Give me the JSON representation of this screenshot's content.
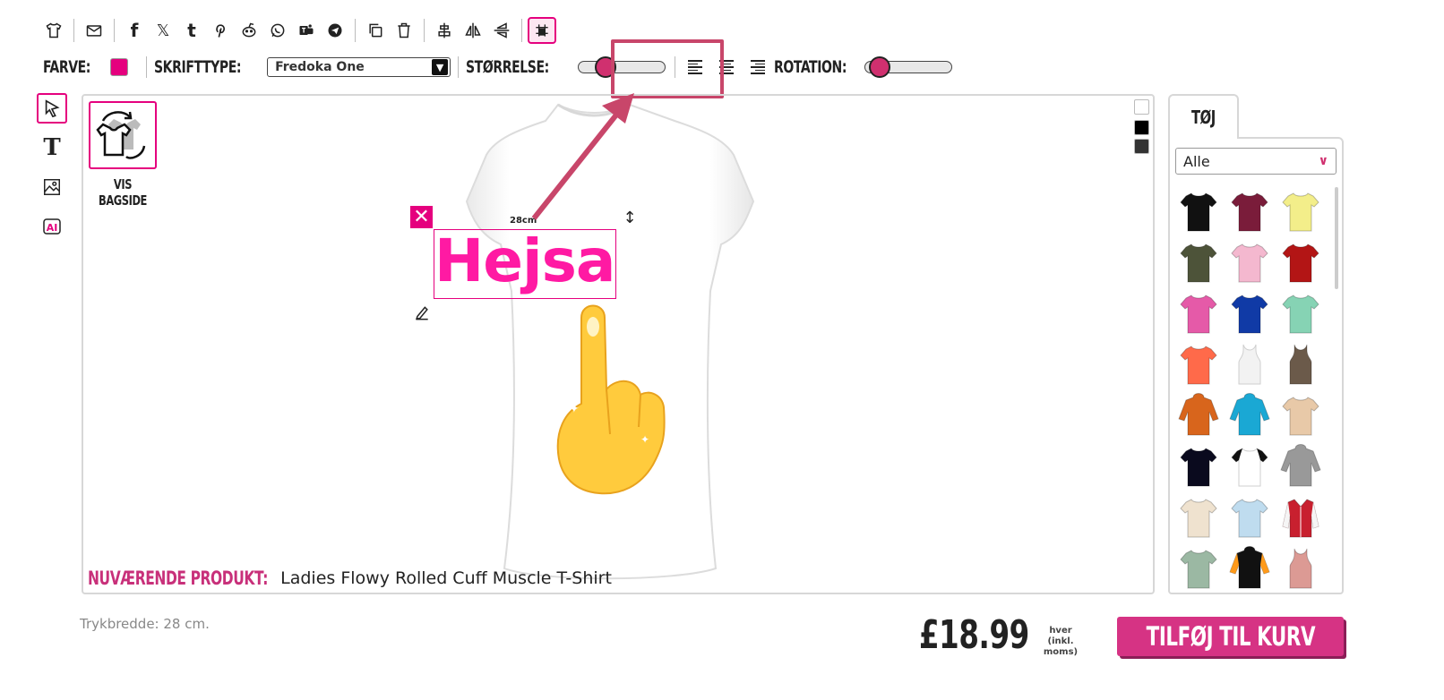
{
  "toolbar": {
    "icons": [
      "tshirt-icon",
      "mail-icon",
      "facebook-icon",
      "x-icon",
      "tumblr-icon",
      "pinterest-icon",
      "reddit-icon",
      "whatsapp-icon",
      "teams-icon",
      "telegram-icon",
      "duplicate-icon",
      "trash-icon",
      "align-center-vertical-icon",
      "flip-horizontal-icon",
      "flip-vertical-icon",
      "print-area-icon"
    ],
    "glyphs": {
      "facebook": "f",
      "x": "𝕏",
      "tumblr": "t"
    }
  },
  "options": {
    "color_label": "FARVE:",
    "color_value": "#e5007e",
    "font_label": "SKRIFTTYPE:",
    "font_value": "Fredoka One",
    "size_label": "STØRRELSE:",
    "size_level": 0.25,
    "rotation_label": "ROTATION:",
    "rotation_level": 0.05
  },
  "canvas": {
    "backside_label_1": "VIS",
    "backside_label_2": "BAGSIDE",
    "text_size_label": "28cm",
    "design_text": "Hejsa",
    "current_product_label": "NUVÆRENDE PRODUKT:",
    "current_product_name": "Ladies Flowy Rolled Cuff Muscle T-Shirt",
    "background_swatches": [
      "#ffffff",
      "#000000",
      "#333333"
    ]
  },
  "panel": {
    "tab_label": "TØJ",
    "filter_value": "Alle",
    "garments": [
      {
        "type": "tee",
        "color": "#111111"
      },
      {
        "type": "tee",
        "color": "#7a1c3a"
      },
      {
        "type": "tee",
        "color": "#f3ee8a"
      },
      {
        "type": "tee",
        "color": "#4d5339"
      },
      {
        "type": "tee",
        "color": "#f4b8cf"
      },
      {
        "type": "tee",
        "color": "#b31515"
      },
      {
        "type": "tee",
        "color": "#e55aa8"
      },
      {
        "type": "tee",
        "color": "#103aa6"
      },
      {
        "type": "tee",
        "color": "#86d3b4"
      },
      {
        "type": "tee",
        "color": "#ff6a4a"
      },
      {
        "type": "tank",
        "color": "#f2f2f2"
      },
      {
        "type": "tank",
        "color": "#6b5a4a"
      },
      {
        "type": "hoodie",
        "color": "#d8651c"
      },
      {
        "type": "hoodie",
        "color": "#1aa8d4"
      },
      {
        "type": "tee",
        "color": "#e8c9a8"
      },
      {
        "type": "tee",
        "color": "#0a0a1e"
      },
      {
        "type": "raglan",
        "color": "#ffffff"
      },
      {
        "type": "hoodie",
        "color": "#999999"
      },
      {
        "type": "tee",
        "color": "#efe2cf"
      },
      {
        "type": "tee",
        "color": "#bfdcef"
      },
      {
        "type": "jacket",
        "color": "#c8202f"
      },
      {
        "type": "tee",
        "color": "#9bb8a3"
      },
      {
        "type": "hoodie",
        "color": "#111111"
      },
      {
        "type": "tank",
        "color": "#dc9a94"
      }
    ]
  },
  "footer": {
    "print_width": "Trykbredde: 28 cm.",
    "price": "£18.99",
    "price_note": "hver (inkl. moms)",
    "cart_button": "TILFØJ TIL KURV"
  }
}
